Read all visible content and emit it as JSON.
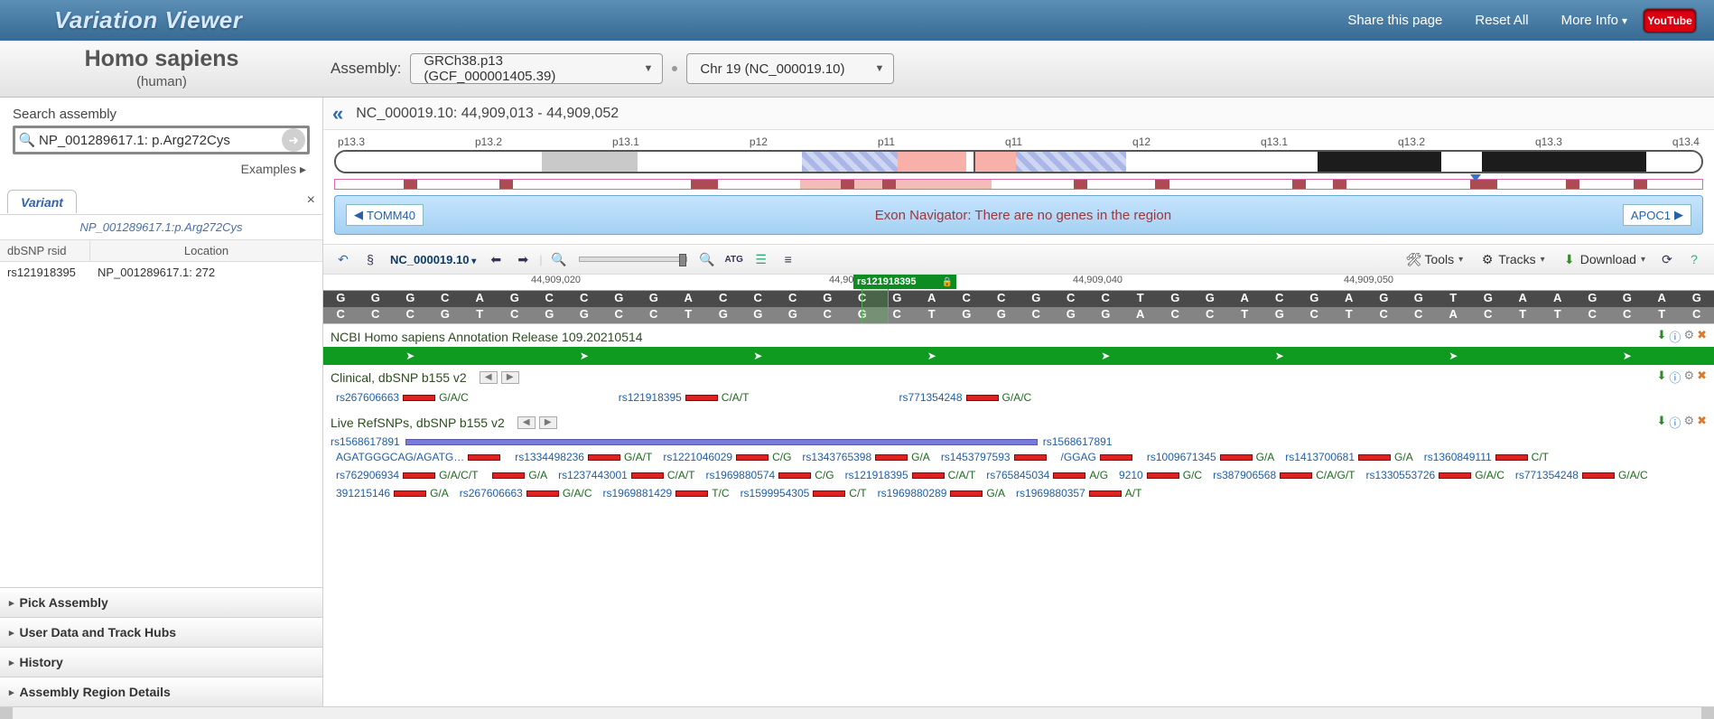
{
  "app": {
    "title": "Variation Viewer"
  },
  "topnav": {
    "share": "Share this page",
    "reset": "Reset All",
    "more": "More Info",
    "youtube": "YouTube"
  },
  "organism": {
    "name": "Homo sapiens",
    "sub": "(human)"
  },
  "controls": {
    "assembly_label": "Assembly:",
    "assembly_value": "GRCh38.p13 (GCF_000001405.39)",
    "chrom_value": "Chr 19 (NC_000019.10)"
  },
  "search": {
    "label": "Search assembly",
    "value": "NP_001289617.1: p.Arg272Cys",
    "examples": "Examples ▸"
  },
  "tabs": {
    "variant": "Variant",
    "close": "×",
    "path": "NP_001289617.1:p.Arg272Cys"
  },
  "grid": {
    "col1": "dbSNP rsid",
    "col2": "Location",
    "row": {
      "rsid": "rs121918395",
      "loc": "NP_001289617.1: 272"
    }
  },
  "accordion": {
    "a1": "Pick Assembly",
    "a2": "User Data and Track Hubs",
    "a3": "History",
    "a4": "Assembly Region Details"
  },
  "locbar": {
    "range": "NC_000019.10: 44,909,013 - 44,909,052"
  },
  "ideogram": {
    "labels": [
      "p13.3",
      "p13.2",
      "p13.1",
      "p12",
      "p11",
      "q11",
      "q12",
      "q13.1",
      "q13.2",
      "q13.3",
      "q13.4"
    ]
  },
  "exon": {
    "left": "TOMM40",
    "right": "APOC1",
    "msg": "Exon Navigator: There are no genes in the region"
  },
  "toolbar": {
    "seq": "NC_000019.10",
    "tools": "Tools",
    "tracks": "Tracks",
    "download": "Download"
  },
  "ruler": {
    "t1": "44,909,020",
    "t2": "44,90",
    "highlighted": "rs121918395",
    "t3": "44,909,040",
    "t4": "44,909,050"
  },
  "sequence": {
    "top": [
      "G",
      "G",
      "G",
      "C",
      "A",
      "G",
      "C",
      "C",
      "G",
      "G",
      "A",
      "C",
      "C",
      "C",
      "G",
      "C",
      "G",
      "A",
      "C",
      "C",
      "G",
      "C",
      "C",
      "T",
      "G",
      "G",
      "A",
      "C",
      "G",
      "A",
      "G",
      "G",
      "T",
      "G",
      "A",
      "A",
      "G",
      "G",
      "A",
      "G"
    ],
    "bottom": [
      "C",
      "C",
      "C",
      "G",
      "T",
      "C",
      "G",
      "G",
      "C",
      "C",
      "T",
      "G",
      "G",
      "G",
      "C",
      "G",
      "C",
      "T",
      "G",
      "G",
      "C",
      "G",
      "G",
      "A",
      "C",
      "C",
      "T",
      "G",
      "C",
      "T",
      "C",
      "C",
      "A",
      "C",
      "T",
      "T",
      "C",
      "C",
      "T",
      "C"
    ]
  },
  "tracks": {
    "anno_release": "NCBI Homo sapiens Annotation Release 109.20210514",
    "clinical_title": "Clinical, dbSNP b155 v2",
    "refsnp_title": "Live RefSNPs, dbSNP b155 v2"
  },
  "clinical_snps": [
    {
      "rsid": "rs267606663",
      "allele": "G/A/C"
    },
    {
      "rsid": "rs121918395",
      "allele": "C/A/T"
    },
    {
      "rsid": "rs771354248",
      "allele": "G/A/C"
    }
  ],
  "refsnps_top": {
    "rsid": "rs1568617891",
    "right_rsid": "rs1568617891"
  },
  "refsnps": [
    {
      "text": "AGATGGGCAG/AGATG…",
      "allele": ""
    },
    {
      "rsid": "rs1334498236",
      "allele": "G/A/T"
    },
    {
      "rsid": "rs1221046029",
      "allele": "C/G"
    },
    {
      "rsid": "rs1343765398",
      "allele": "G/A"
    },
    {
      "rsid": "rs1453797593",
      "allele": ""
    },
    {
      "text": "/GGAG",
      "allele": ""
    },
    {
      "rsid": "rs1009671345",
      "allele": "G/A"
    },
    {
      "rsid": "rs1413700681",
      "allele": "G/A"
    },
    {
      "rsid": "rs1360849111",
      "allele": "C/T"
    },
    {
      "rsid": "rs762906934",
      "allele": "G/A/C/T"
    },
    {
      "rsid": "",
      "allele": "G/A"
    },
    {
      "rsid": "rs1237443001",
      "allele": "C/A/T"
    },
    {
      "rsid": "rs1969880574",
      "allele": "C/G"
    },
    {
      "rsid": "rs121918395",
      "allele": "C/A/T"
    },
    {
      "rsid": "rs765845034",
      "allele": "A/G"
    },
    {
      "text": "9210",
      "allele": "G/C"
    },
    {
      "rsid": "rs387906568",
      "allele": "C/A/G/T"
    },
    {
      "rsid": "rs1330553726",
      "allele": "G/A/C"
    },
    {
      "rsid": "rs771354248",
      "allele": "G/A/C"
    },
    {
      "text": "391215146",
      "allele": "G/A"
    },
    {
      "rsid": "rs267606663",
      "allele": "G/A/C"
    },
    {
      "rsid": "rs1969881429",
      "allele": "T/C"
    },
    {
      "rsid": "rs1599954305",
      "allele": "C/T"
    },
    {
      "rsid": "rs1969880289",
      "allele": "G/A"
    },
    {
      "rsid": "rs1969880357",
      "allele": "A/T"
    }
  ]
}
